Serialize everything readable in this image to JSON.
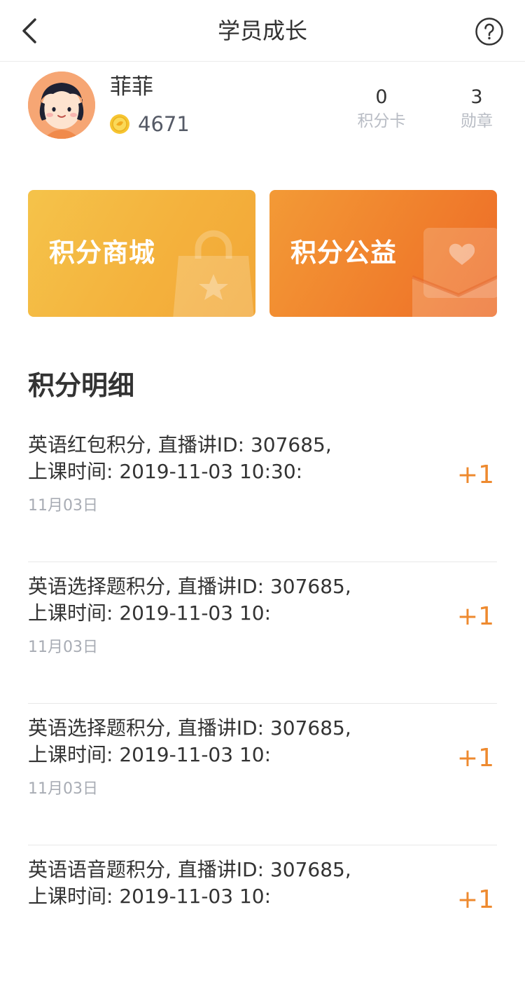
{
  "nav": {
    "title": "学员成长",
    "back_icon": "chevron-left-icon",
    "help_icon": "question-circle-icon"
  },
  "profile": {
    "name": "菲菲",
    "coins": "4671",
    "coin_icon": "coin-icon",
    "stats": [
      {
        "value": "0",
        "label": "积分卡"
      },
      {
        "value": "3",
        "label": "勋章"
      }
    ]
  },
  "cards": {
    "mall": {
      "label": "积分商城",
      "icon": "shopping-bag-star-icon"
    },
    "charity": {
      "label": "积分公益",
      "icon": "envelope-heart-icon"
    }
  },
  "points_detail": {
    "title": "积分明细",
    "items": [
      {
        "desc": "英语红包积分, 直播讲ID: 307685, 上课时间: 2019-11-03 10:30:",
        "date": "11月03日",
        "points": "+1"
      },
      {
        "desc": "英语选择题积分, 直播讲ID: 307685, 上课时间: 2019-11-03 10:",
        "date": "11月03日",
        "points": "+1"
      },
      {
        "desc": "英语选择题积分, 直播讲ID: 307685, 上课时间: 2019-11-03 10:",
        "date": "11月03日",
        "points": "+1"
      },
      {
        "desc": "英语语音题积分, 直播讲ID: 307685, 上课时间: 2019-11-03 10:",
        "date": "",
        "points": "+1"
      }
    ]
  },
  "colors": {
    "accent_orange": "#ee8a2f",
    "mall_card": "#f4b23d",
    "charity_card": "#f07e2c"
  }
}
